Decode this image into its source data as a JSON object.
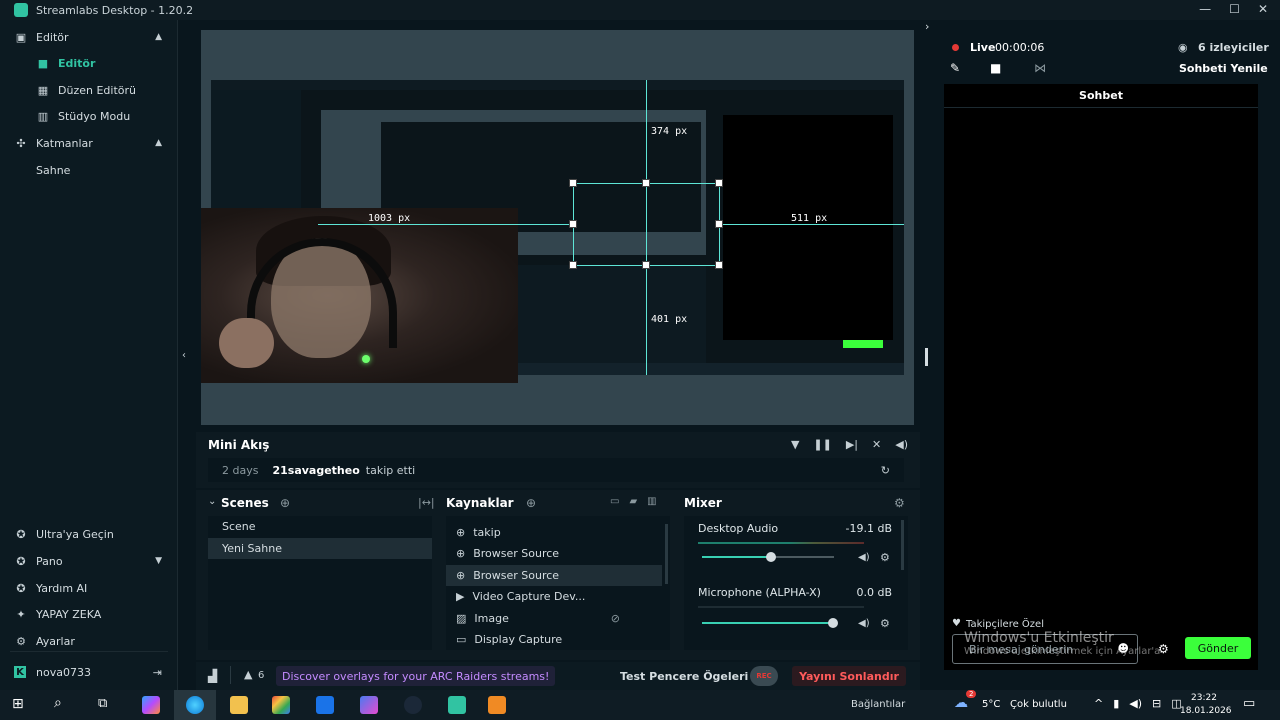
{
  "window": {
    "title": "Streamlabs Desktop - 1.20.2"
  },
  "sidebar": {
    "editor_section": "Editör",
    "items": [
      {
        "label": "Editör",
        "icon": "editor-icon",
        "active": true
      },
      {
        "label": "Düzen Editörü",
        "icon": "layout-grid-icon"
      },
      {
        "label": "Stüdyo Modu",
        "icon": "studio-columns-icon"
      }
    ],
    "layers_section": "Katmanlar",
    "scene_label": "Sahne",
    "bottom_items": [
      {
        "label": "Ultra'ya Geçin",
        "icon": "ultra-icon"
      },
      {
        "label": "Pano",
        "icon": "dashboard-icon"
      },
      {
        "label": "Yardım AI",
        "icon": "help-ai-icon"
      },
      {
        "label": "YAPAY ZEKA",
        "icon": "ai-sparkle-icon"
      },
      {
        "label": "Ayarlar",
        "icon": "gear-icon"
      }
    ],
    "user": "nova0733"
  },
  "preview": {
    "measure_top": "374 px",
    "measure_left": "1003 px",
    "measure_right": "511 px",
    "measure_bottom": "401 px"
  },
  "mini_flow": {
    "title": "Mini Akış",
    "event": {
      "time": "2 days",
      "user": "21savagetheo",
      "action": "takip etti"
    }
  },
  "scenes": {
    "title": "Scenes",
    "items": [
      "Scene",
      "Yeni Sahne"
    ],
    "selected": 1
  },
  "sources": {
    "title": "Kaynaklar",
    "items": [
      {
        "label": "takip",
        "icon": "globe-icon"
      },
      {
        "label": "Browser Source",
        "icon": "globe-icon"
      },
      {
        "label": "Browser Source",
        "icon": "globe-icon",
        "selected": true
      },
      {
        "label": "Video Capture Dev...",
        "icon": "camera-icon"
      },
      {
        "label": "Image",
        "icon": "image-icon",
        "hidden": true
      },
      {
        "label": "Display Capture",
        "icon": "monitor-icon"
      }
    ]
  },
  "mixer": {
    "title": "Mixer",
    "channels": [
      {
        "name": "Desktop Audio",
        "level": "-19.1 dB",
        "volume": 0.5
      },
      {
        "name": "Microphone (ALPHA-X)",
        "level": "0.0 dB",
        "volume": 1.0
      }
    ]
  },
  "statusbar": {
    "alerts_count": "6",
    "promo": "Discover overlays for your ARC Raiders streams!",
    "test_label": "Test Pencere Ögeleri",
    "rec_label": "REC",
    "end_stream": "Yayını Sonlandır"
  },
  "live": {
    "status": "Live",
    "time": "00:00:06",
    "viewers": "6 izleyiciler",
    "refresh_chat": "Sohbeti Yenile"
  },
  "chat": {
    "title": "Sohbet",
    "followers_only": "Takipçilere Özel",
    "placeholder": "Bir mesaj gönderin",
    "send": "Gönder"
  },
  "watermark": {
    "line1": "Windows'u Etkinleştir",
    "line2": "Windows'u etkinleştirmek için Ayarlar'a"
  },
  "taskbar": {
    "connections": "Bağlantılar",
    "weather_temp": "5°C",
    "weather_desc": "Çok bulutlu",
    "time": "23:22",
    "date": "18.01.2026",
    "notification_count": "2"
  },
  "colors": {
    "accent": "#31c3a2",
    "send_button": "#3bff3b",
    "live_dot": "#e53935",
    "end_stream": "#ff5b5b",
    "promo_text": "#c48bff"
  }
}
